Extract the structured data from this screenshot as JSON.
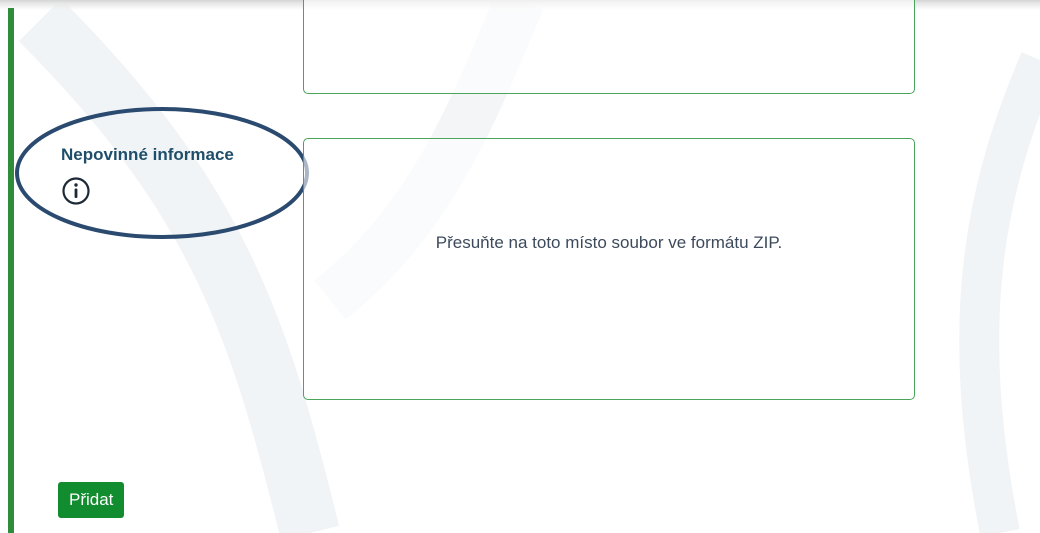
{
  "optional_section": {
    "label": "Nepovinné informace",
    "info_icon": "info-circle-icon"
  },
  "dropzone": {
    "hint": "Přesuňte na toto místo soubor ve formátu ZIP."
  },
  "actions": {
    "add_label": "Přidat"
  },
  "colors": {
    "accent_green": "#118c2e",
    "rail_green": "#2f8c3a",
    "border_green": "#4aa45a",
    "label_blue": "#1f4e6b",
    "annotation_navy": "#2b4a70",
    "text_gray": "#3d4a5c"
  }
}
